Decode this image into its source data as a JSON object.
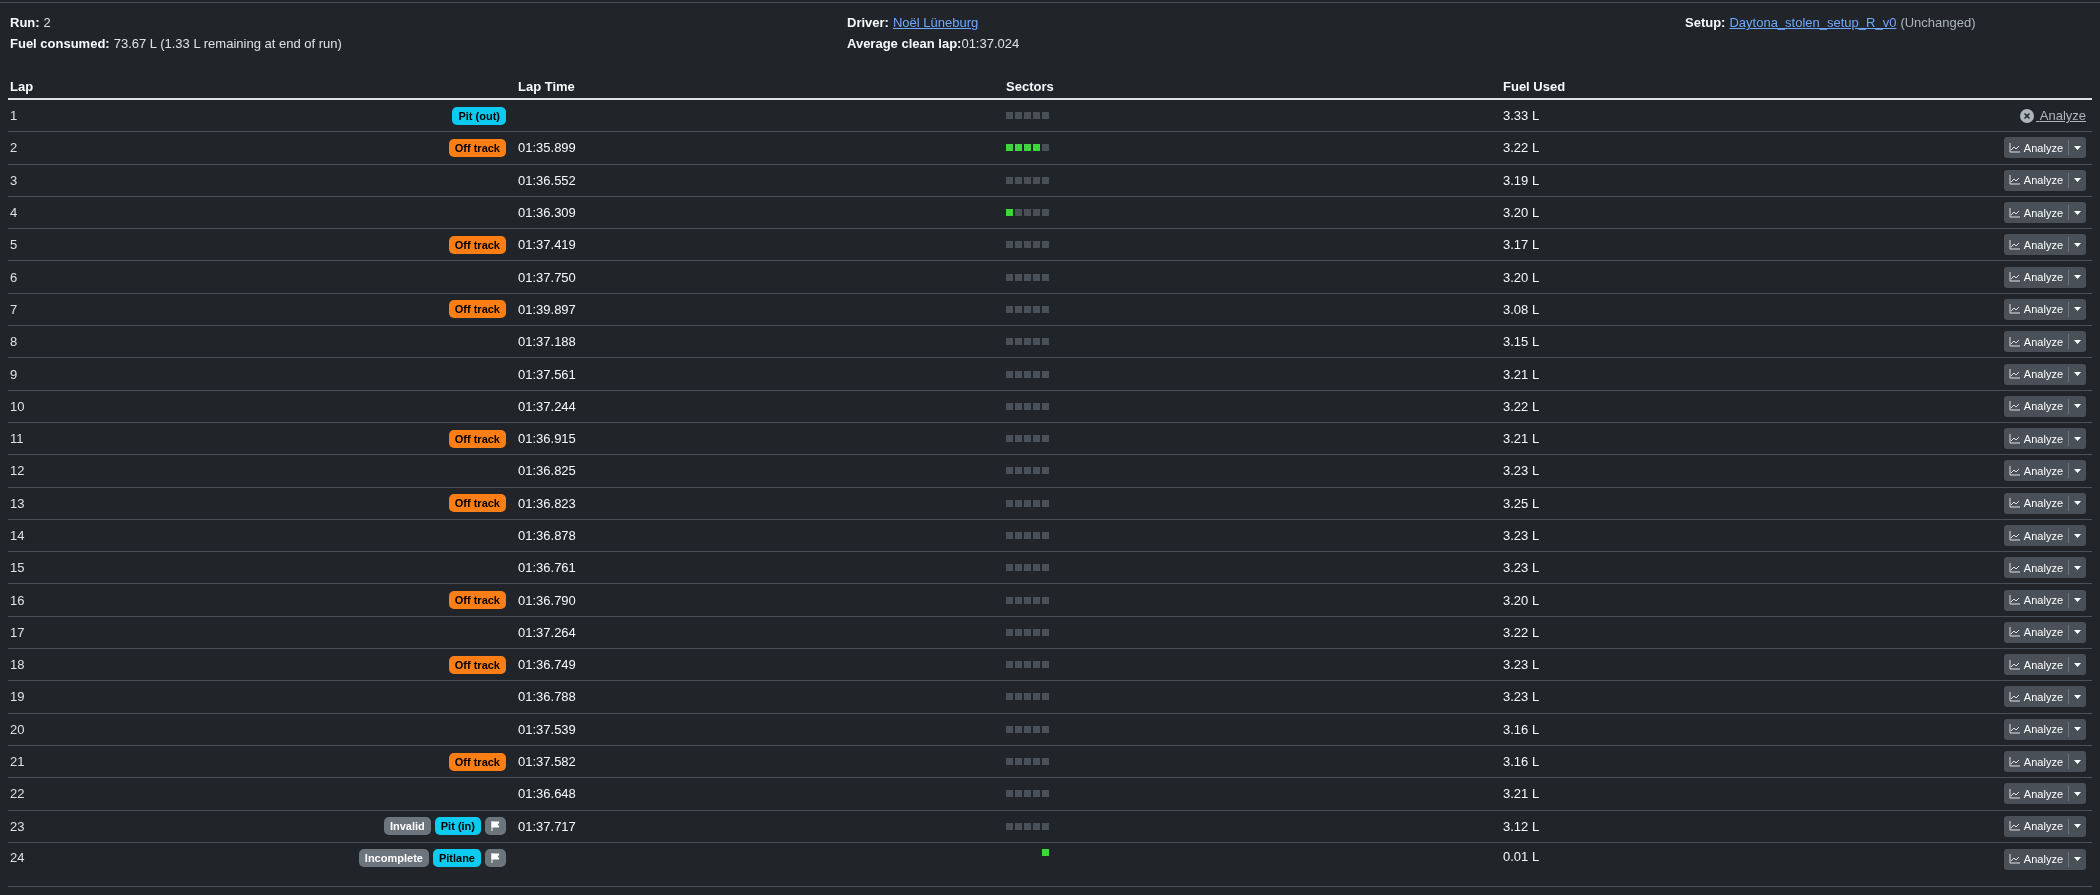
{
  "summary": {
    "run_label": "Run:",
    "run": "2",
    "fuel_label": "Fuel consumed:",
    "fuel": "73.67 L (1.33 L remaining at end of run)",
    "driver_label": "Driver:",
    "driver": "Noël Lüneburg",
    "avg_label": "Average clean lap:",
    "avg": "01:37.024",
    "setup_label": "Setup:",
    "setup": "Daytona_stolen_setup_R_v0",
    "setup_note": "(Unchanged)"
  },
  "table": {
    "columns": [
      "Lap",
      "Lap Time",
      "Sectors",
      "Fuel Used"
    ],
    "rows": [
      {
        "lap": "1",
        "badges": [
          {
            "kind": "pit",
            "label": "Pit (out)"
          }
        ],
        "time": "",
        "sectors": [
          {
            "kind": "normal"
          },
          {
            "kind": "normal"
          },
          {
            "kind": "normal"
          },
          {
            "kind": "normal"
          },
          {
            "kind": "normal"
          }
        ],
        "fuel": "3.33 L",
        "analyze": {
          "kind": "link",
          "label": "Analyze"
        }
      },
      {
        "lap": "2",
        "badges": [
          {
            "kind": "offtrack",
            "label": "Off track"
          }
        ],
        "time": "01:35.899",
        "sectors": [
          {
            "kind": "best"
          },
          {
            "kind": "best"
          },
          {
            "kind": "best"
          },
          {
            "kind": "best"
          },
          {
            "kind": "normal"
          }
        ],
        "fuel": "3.22 L",
        "analyze": {
          "kind": "split",
          "label": "Analyze"
        }
      },
      {
        "lap": "3",
        "badges": [],
        "time": "01:36.552",
        "sectors": [
          {
            "kind": "normal"
          },
          {
            "kind": "normal"
          },
          {
            "kind": "normal"
          },
          {
            "kind": "normal"
          },
          {
            "kind": "normal"
          }
        ],
        "fuel": "3.19 L",
        "analyze": {
          "kind": "split",
          "label": "Analyze"
        }
      },
      {
        "lap": "4",
        "badges": [],
        "time": "01:36.309",
        "sectors": [
          {
            "kind": "best"
          },
          {
            "kind": "normal"
          },
          {
            "kind": "normal"
          },
          {
            "kind": "normal"
          },
          {
            "kind": "normal"
          }
        ],
        "fuel": "3.20 L",
        "analyze": {
          "kind": "split",
          "label": "Analyze"
        }
      },
      {
        "lap": "5",
        "badges": [
          {
            "kind": "offtrack",
            "label": "Off track"
          }
        ],
        "time": "01:37.419",
        "sectors": [
          {
            "kind": "normal"
          },
          {
            "kind": "normal"
          },
          {
            "kind": "normal"
          },
          {
            "kind": "normal"
          },
          {
            "kind": "normal"
          }
        ],
        "fuel": "3.17 L",
        "analyze": {
          "kind": "split",
          "label": "Analyze"
        }
      },
      {
        "lap": "6",
        "badges": [],
        "time": "01:37.750",
        "sectors": [
          {
            "kind": "normal"
          },
          {
            "kind": "normal"
          },
          {
            "kind": "normal"
          },
          {
            "kind": "normal"
          },
          {
            "kind": "normal"
          }
        ],
        "fuel": "3.20 L",
        "analyze": {
          "kind": "split",
          "label": "Analyze"
        }
      },
      {
        "lap": "7",
        "badges": [
          {
            "kind": "offtrack",
            "label": "Off track"
          }
        ],
        "time": "01:39.897",
        "sectors": [
          {
            "kind": "normal"
          },
          {
            "kind": "normal"
          },
          {
            "kind": "normal"
          },
          {
            "kind": "normal"
          },
          {
            "kind": "normal"
          }
        ],
        "fuel": "3.08 L",
        "analyze": {
          "kind": "split",
          "label": "Analyze"
        }
      },
      {
        "lap": "8",
        "badges": [],
        "time": "01:37.188",
        "sectors": [
          {
            "kind": "normal"
          },
          {
            "kind": "normal"
          },
          {
            "kind": "normal"
          },
          {
            "kind": "normal"
          },
          {
            "kind": "normal"
          }
        ],
        "fuel": "3.15 L",
        "analyze": {
          "kind": "split",
          "label": "Analyze"
        }
      },
      {
        "lap": "9",
        "badges": [],
        "time": "01:37.561",
        "sectors": [
          {
            "kind": "normal"
          },
          {
            "kind": "normal"
          },
          {
            "kind": "normal"
          },
          {
            "kind": "normal"
          },
          {
            "kind": "normal"
          }
        ],
        "fuel": "3.21 L",
        "analyze": {
          "kind": "split",
          "label": "Analyze"
        }
      },
      {
        "lap": "10",
        "badges": [],
        "time": "01:37.244",
        "sectors": [
          {
            "kind": "normal"
          },
          {
            "kind": "normal"
          },
          {
            "kind": "normal"
          },
          {
            "kind": "normal"
          },
          {
            "kind": "normal"
          }
        ],
        "fuel": "3.22 L",
        "analyze": {
          "kind": "split",
          "label": "Analyze"
        }
      },
      {
        "lap": "11",
        "badges": [
          {
            "kind": "offtrack",
            "label": "Off track"
          }
        ],
        "time": "01:36.915",
        "sectors": [
          {
            "kind": "normal"
          },
          {
            "kind": "normal"
          },
          {
            "kind": "normal"
          },
          {
            "kind": "normal"
          },
          {
            "kind": "normal"
          }
        ],
        "fuel": "3.21 L",
        "analyze": {
          "kind": "split",
          "label": "Analyze"
        }
      },
      {
        "lap": "12",
        "badges": [],
        "time": "01:36.825",
        "sectors": [
          {
            "kind": "normal"
          },
          {
            "kind": "normal"
          },
          {
            "kind": "normal"
          },
          {
            "kind": "normal"
          },
          {
            "kind": "normal"
          }
        ],
        "fuel": "3.23 L",
        "analyze": {
          "kind": "split",
          "label": "Analyze"
        }
      },
      {
        "lap": "13",
        "badges": [
          {
            "kind": "offtrack",
            "label": "Off track"
          }
        ],
        "time": "01:36.823",
        "sectors": [
          {
            "kind": "normal"
          },
          {
            "kind": "normal"
          },
          {
            "kind": "normal"
          },
          {
            "kind": "normal"
          },
          {
            "kind": "normal"
          }
        ],
        "fuel": "3.25 L",
        "analyze": {
          "kind": "split",
          "label": "Analyze"
        }
      },
      {
        "lap": "14",
        "badges": [],
        "time": "01:36.878",
        "sectors": [
          {
            "kind": "normal"
          },
          {
            "kind": "normal"
          },
          {
            "kind": "normal"
          },
          {
            "kind": "normal"
          },
          {
            "kind": "normal"
          }
        ],
        "fuel": "3.23 L",
        "analyze": {
          "kind": "split",
          "label": "Analyze"
        }
      },
      {
        "lap": "15",
        "badges": [],
        "time": "01:36.761",
        "sectors": [
          {
            "kind": "normal"
          },
          {
            "kind": "normal"
          },
          {
            "kind": "normal"
          },
          {
            "kind": "normal"
          },
          {
            "kind": "normal"
          }
        ],
        "fuel": "3.23 L",
        "analyze": {
          "kind": "split",
          "label": "Analyze"
        }
      },
      {
        "lap": "16",
        "badges": [
          {
            "kind": "offtrack",
            "label": "Off track"
          }
        ],
        "time": "01:36.790",
        "sectors": [
          {
            "kind": "normal"
          },
          {
            "kind": "normal"
          },
          {
            "kind": "normal"
          },
          {
            "kind": "normal"
          },
          {
            "kind": "normal"
          }
        ],
        "fuel": "3.20 L",
        "analyze": {
          "kind": "split",
          "label": "Analyze"
        }
      },
      {
        "lap": "17",
        "badges": [],
        "time": "01:37.264",
        "sectors": [
          {
            "kind": "normal"
          },
          {
            "kind": "normal"
          },
          {
            "kind": "normal"
          },
          {
            "kind": "normal"
          },
          {
            "kind": "normal"
          }
        ],
        "fuel": "3.22 L",
        "analyze": {
          "kind": "split",
          "label": "Analyze"
        }
      },
      {
        "lap": "18",
        "badges": [
          {
            "kind": "offtrack",
            "label": "Off track"
          }
        ],
        "time": "01:36.749",
        "sectors": [
          {
            "kind": "normal"
          },
          {
            "kind": "normal"
          },
          {
            "kind": "normal"
          },
          {
            "kind": "normal"
          },
          {
            "kind": "normal"
          }
        ],
        "fuel": "3.23 L",
        "analyze": {
          "kind": "split",
          "label": "Analyze"
        }
      },
      {
        "lap": "19",
        "badges": [],
        "time": "01:36.788",
        "sectors": [
          {
            "kind": "normal"
          },
          {
            "kind": "normal"
          },
          {
            "kind": "normal"
          },
          {
            "kind": "normal"
          },
          {
            "kind": "normal"
          }
        ],
        "fuel": "3.23 L",
        "analyze": {
          "kind": "split",
          "label": "Analyze"
        }
      },
      {
        "lap": "20",
        "badges": [],
        "time": "01:37.539",
        "sectors": [
          {
            "kind": "normal"
          },
          {
            "kind": "normal"
          },
          {
            "kind": "normal"
          },
          {
            "kind": "normal"
          },
          {
            "kind": "normal"
          }
        ],
        "fuel": "3.16 L",
        "analyze": {
          "kind": "split",
          "label": "Analyze"
        }
      },
      {
        "lap": "21",
        "badges": [
          {
            "kind": "offtrack",
            "label": "Off track"
          }
        ],
        "time": "01:37.582",
        "sectors": [
          {
            "kind": "normal"
          },
          {
            "kind": "normal"
          },
          {
            "kind": "normal"
          },
          {
            "kind": "normal"
          },
          {
            "kind": "normal"
          }
        ],
        "fuel": "3.16 L",
        "analyze": {
          "kind": "split",
          "label": "Analyze"
        }
      },
      {
        "lap": "22",
        "badges": [],
        "time": "01:36.648",
        "sectors": [
          {
            "kind": "normal"
          },
          {
            "kind": "normal"
          },
          {
            "kind": "normal"
          },
          {
            "kind": "normal"
          },
          {
            "kind": "normal"
          }
        ],
        "fuel": "3.21 L",
        "analyze": {
          "kind": "split",
          "label": "Analyze"
        }
      },
      {
        "lap": "23",
        "badges": [
          {
            "kind": "invalid",
            "label": "Invalid"
          },
          {
            "kind": "pit",
            "label": "Pit (in)"
          },
          {
            "kind": "flag"
          }
        ],
        "time": "01:37.717",
        "sectors": [
          {
            "kind": "normal"
          },
          {
            "kind": "normal"
          },
          {
            "kind": "normal"
          },
          {
            "kind": "normal"
          },
          {
            "kind": "normal"
          }
        ],
        "fuel": "3.12 L",
        "analyze": {
          "kind": "split",
          "label": "Analyze"
        }
      },
      {
        "lap": "24",
        "badges": [
          {
            "kind": "invalid",
            "label": "Incomplete"
          },
          {
            "kind": "pit",
            "label": "Pitlane"
          },
          {
            "kind": "flag"
          }
        ],
        "time": "",
        "sectors": [
          {
            "kind": "none"
          },
          {
            "kind": "none"
          },
          {
            "kind": "none"
          },
          {
            "kind": "none"
          },
          {
            "kind": "best"
          }
        ],
        "fuel": "0.01 L",
        "analyze": {
          "kind": "split",
          "label": "Analyze"
        }
      }
    ]
  }
}
